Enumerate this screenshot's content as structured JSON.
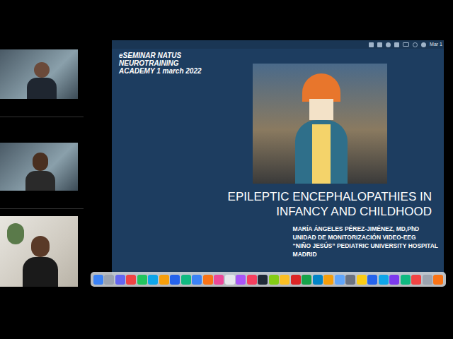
{
  "menubar": {
    "clock": "Mar 1"
  },
  "slide": {
    "header": [
      "eSEMINAR NATUS",
      "NEUROTRAINING",
      "ACADEMY 1 march 2022"
    ],
    "title": [
      "EPILEPTIC ENCEPHALOPATHIES IN",
      "INFANCY AND CHILDHOOD"
    ],
    "authors": [
      "MARÍA ÁNGELES PÉREZ-JIMÉNEZ, MD,PhD",
      "UNIDAD DE MONITORIZACIÓN VIDEO-EEG",
      "“NIÑO JESÚS” PEDIATRIC UNIVERSITY HOSPITAL",
      "MADRID"
    ]
  },
  "dock": {
    "icons": [
      {
        "color": "#3b82f6"
      },
      {
        "color": "#9ca3af"
      },
      {
        "color": "#6366f1"
      },
      {
        "color": "#ef4444"
      },
      {
        "color": "#22c55e"
      },
      {
        "color": "#0ea5e9"
      },
      {
        "color": "#f59e0b"
      },
      {
        "color": "#2563eb"
      },
      {
        "color": "#10b981"
      },
      {
        "color": "#3b82f6"
      },
      {
        "color": "#f97316"
      },
      {
        "color": "#ec4899"
      },
      {
        "color": "#e5e7eb"
      },
      {
        "color": "#a855f7"
      },
      {
        "color": "#f43f5e"
      },
      {
        "color": "#1f2937"
      },
      {
        "color": "#84cc16"
      },
      {
        "color": "#fbbf24"
      },
      {
        "color": "#dc2626"
      },
      {
        "color": "#16a34a"
      },
      {
        "color": "#0284c7"
      },
      {
        "color": "#f59e0b"
      },
      {
        "color": "#60a5fa"
      },
      {
        "color": "#6b7280"
      },
      {
        "color": "#facc15"
      },
      {
        "color": "#2563eb"
      },
      {
        "color": "#0ea5e9"
      },
      {
        "color": "#7c3aed"
      },
      {
        "color": "#10b981"
      },
      {
        "color": "#ef4444"
      },
      {
        "color": "#9ca3af"
      },
      {
        "color": "#f97316"
      }
    ]
  }
}
